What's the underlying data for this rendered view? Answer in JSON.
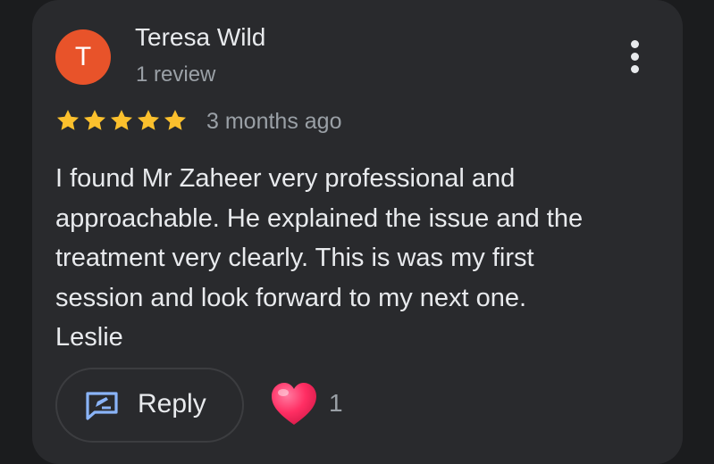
{
  "review": {
    "avatar_initial": "T",
    "author_name": "Teresa Wild",
    "author_review_count": "1 review",
    "rating": 5,
    "rating_max": 5,
    "time_ago": "3 months ago",
    "text_lines": [
      "I found Mr Zaheer very professional and",
      "approachable. He explained the issue and the",
      "treatment very clearly. This is was my first",
      "session and look forward to my next one.",
      "Leslie"
    ],
    "reply_label": "Reply",
    "like_count": "1"
  },
  "icons": {
    "more": "more-vertical-icon",
    "star": "star-icon",
    "reply": "reply-edit-icon",
    "heart": "heart-icon"
  },
  "colors": {
    "background": "#1b1c1e",
    "card": "#292a2d",
    "avatar": "#e8532a",
    "star": "#fbc02d",
    "reply_icon": "#8ab4f8",
    "heart": "#ff2e63",
    "primary_text": "#e8eaed",
    "secondary_text": "#9aa0a6"
  }
}
